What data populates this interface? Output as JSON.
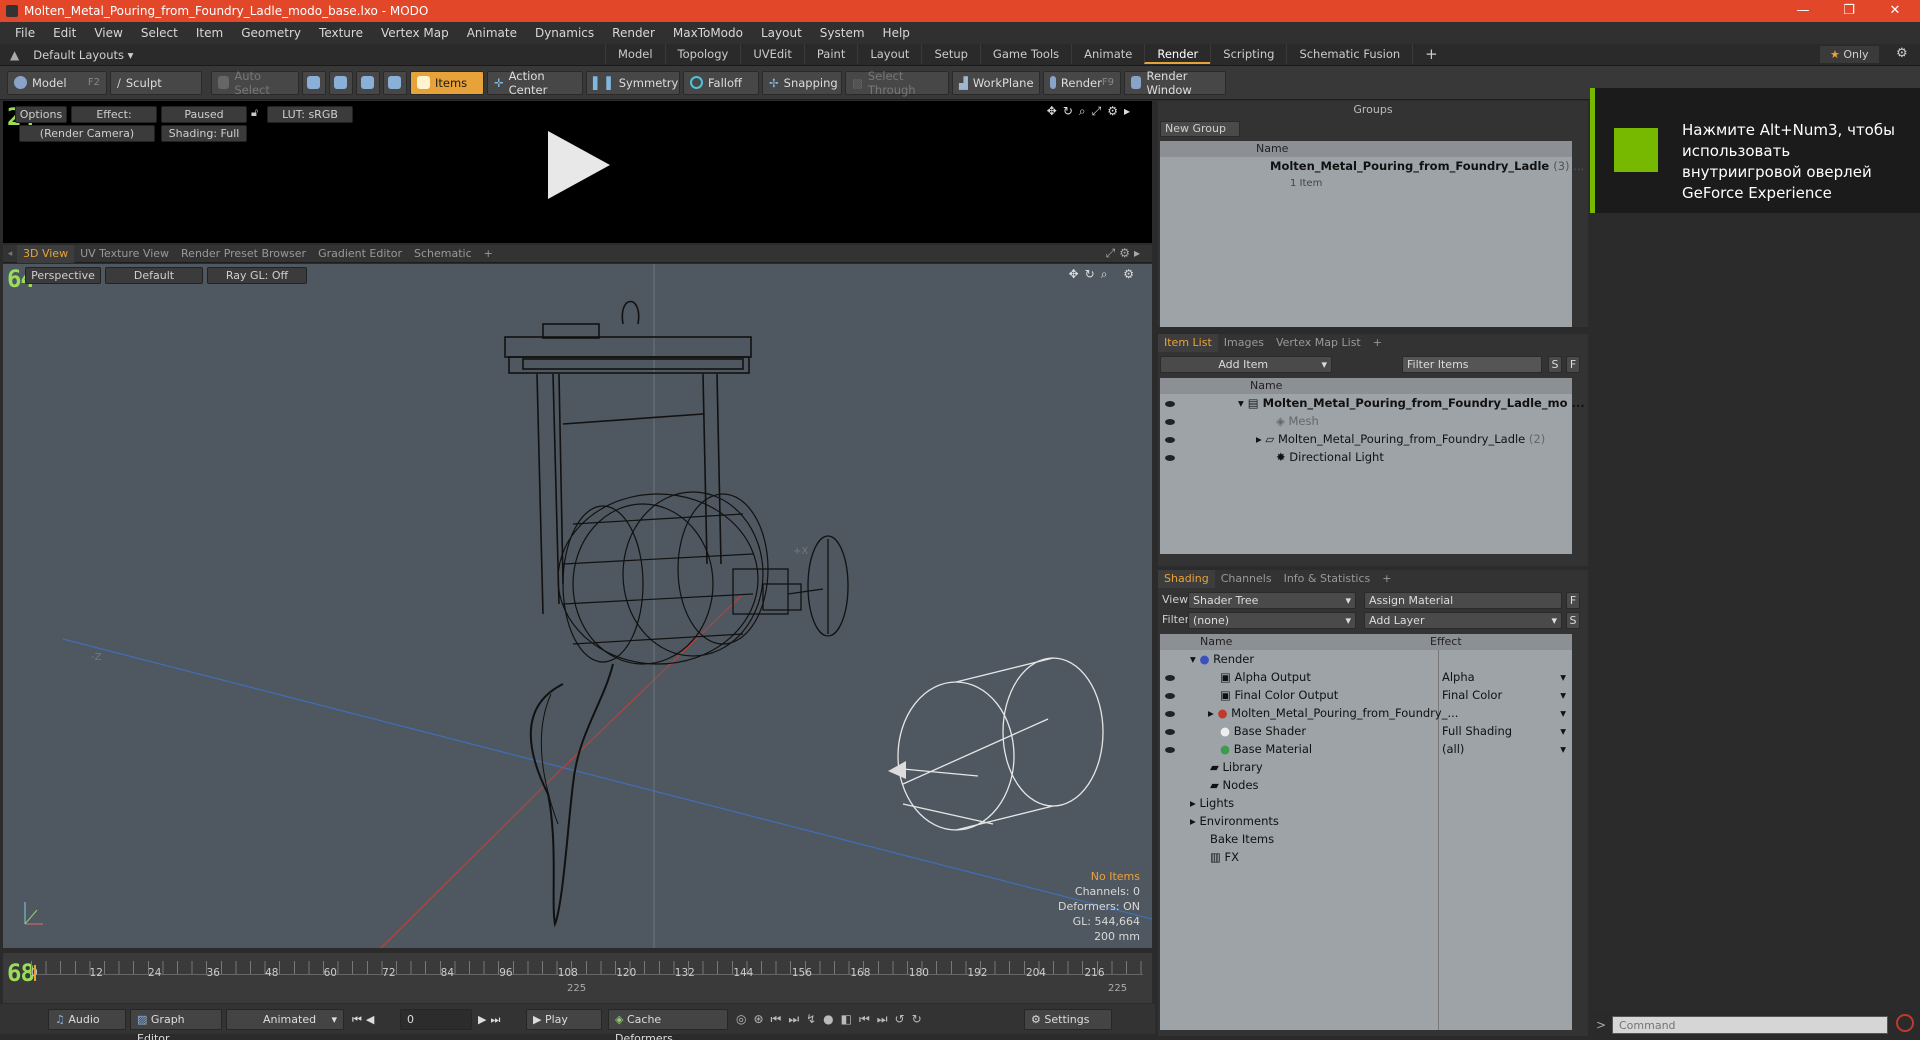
{
  "window": {
    "title": "Molten_Metal_Pouring_from_Foundry_Ladle_modo_base.lxo - MODO",
    "controls": [
      "—",
      "❐",
      "✕"
    ]
  },
  "menu": [
    "File",
    "Edit",
    "View",
    "Select",
    "Item",
    "Geometry",
    "Texture",
    "Vertex Map",
    "Animate",
    "Dynamics",
    "Render",
    "MaxToModo",
    "Layout",
    "System",
    "Help"
  ],
  "layoutbar": {
    "layouts_label": "Default Layouts",
    "tabs": [
      "Model",
      "Topology",
      "UVEdit",
      "Paint",
      "Layout",
      "Setup",
      "Game Tools",
      "Animate",
      "Render",
      "Scripting",
      "Schematic Fusion"
    ],
    "active": "Render",
    "only_label": "Only"
  },
  "toolbar": {
    "model": "Model",
    "model_key": "F2",
    "sculpt": "Sculpt",
    "auto_select": "Auto Select",
    "items": "Items",
    "action_center": "Action Center",
    "symmetry": "Symmetry",
    "falloff": "Falloff",
    "snapping": "Snapping",
    "select_through": "Select Through",
    "workplane": "WorkPlane",
    "render": "Render",
    "render_key": "F9",
    "render_window": "Render Window"
  },
  "render_panel": {
    "counter": "24",
    "options": "Options",
    "effect": "Effect: (Shadi...",
    "paused": "Paused",
    "lut": "LUT: sRGB",
    "camera": "(Render Camera)",
    "shading": "Shading: Full"
  },
  "viewport_tabs": [
    "3D View",
    "UV Texture View",
    "Render Preset Browser",
    "Gradient Editor",
    "Schematic",
    "+"
  ],
  "viewport": {
    "counter": "64",
    "perspective": "Perspective",
    "default": "Default",
    "raygl": "Ray GL: Off",
    "axis_neg_z": "-Z",
    "axis_pos_x": "+X",
    "hud": {
      "no_items": "No Items",
      "channels": "Channels: 0",
      "deformers": "Deformers: ON",
      "gl": "GL: 544,664",
      "scale": "200 mm"
    }
  },
  "timeline": {
    "counter": "68",
    "ticks": [
      "0",
      "12",
      "24",
      "36",
      "48",
      "60",
      "72",
      "84",
      "96",
      "108",
      "120",
      "132",
      "144",
      "156",
      "168",
      "180",
      "192",
      "204",
      "216"
    ],
    "end_mid": "225",
    "end_right": "225"
  },
  "bottom": {
    "audio": "Audio",
    "graph_editor": "Graph Editor",
    "animated": "Animated",
    "frame": "0",
    "play": "Play",
    "cache": "Cache Deformers",
    "settings": "Settings"
  },
  "groups": {
    "title": "Groups",
    "new_group": "New Group",
    "col_name": "Name",
    "item_name": "Molten_Metal_Pouring_from_Foundry_Ladle",
    "item_count": "(3) ...",
    "item_sub": "1 Item"
  },
  "itemlist": {
    "tabs": [
      "Item List",
      "Images",
      "Vertex Map List",
      "+"
    ],
    "add_item": "Add Item",
    "filter": "Filter Items",
    "s": "S",
    "f": "F",
    "col_name": "Name",
    "rows": [
      {
        "label": "Molten_Metal_Pouring_from_Foundry_Ladle_mo ...",
        "bold": true
      },
      {
        "label": "Mesh",
        "dim": true
      },
      {
        "label": "Molten_Metal_Pouring_from_Foundry_Ladle",
        "suffix": "(2)"
      },
      {
        "label": "Directional Light"
      }
    ]
  },
  "shading": {
    "tabs": [
      "Shading",
      "Channels",
      "Info & Statistics",
      "+"
    ],
    "view_label": "View",
    "view_value": "Shader Tree",
    "assign": "Assign Material",
    "f": "F",
    "filter_label": "Filter",
    "filter_value": "(none)",
    "add_layer": "Add Layer",
    "s": "S",
    "col_name": "Name",
    "col_effect": "Effect",
    "rows": [
      {
        "name": "Render",
        "effect": ""
      },
      {
        "name": "Alpha Output",
        "effect": "Alpha"
      },
      {
        "name": "Final Color Output",
        "effect": "Final Color"
      },
      {
        "name": "Molten_Metal_Pouring_from_Foundry_...",
        "effect": ""
      },
      {
        "name": "Base Shader",
        "effect": "Full Shading"
      },
      {
        "name": "Base Material",
        "effect": "(all)"
      },
      {
        "name": "Library",
        "effect": ""
      },
      {
        "name": "Nodes",
        "effect": ""
      },
      {
        "name": "Lights",
        "effect": ""
      },
      {
        "name": "Environments",
        "effect": ""
      },
      {
        "name": "Bake Items",
        "effect": ""
      },
      {
        "name": "FX",
        "effect": ""
      }
    ]
  },
  "nvidia": {
    "text": "Нажмите Alt+Num3, чтобы использовать внутриигровой оверлей GeForce Experience"
  },
  "command": {
    "placeholder": "Command",
    "prompt": ">"
  },
  "colors": {
    "title_bar": "#e2472a",
    "accent": "#e8a23a",
    "nvidia_green": "#76b900"
  }
}
